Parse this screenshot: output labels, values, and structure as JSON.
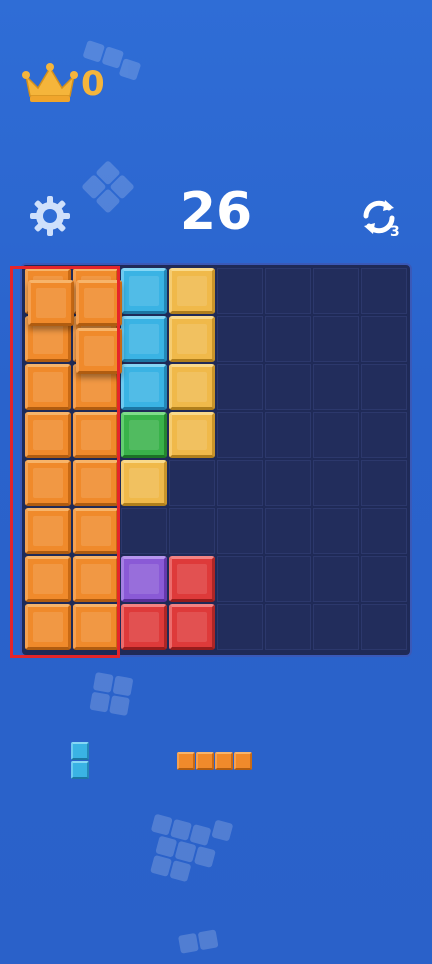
{
  "best_score": "0",
  "score": "26",
  "refresh_count": "3",
  "icons": {
    "crown": "crown-icon",
    "settings": "gear-icon",
    "refresh": "refresh-icon"
  },
  "colors": {
    "background": "#2a63cc",
    "board": "#1f2a57",
    "highlight": "#e5252a",
    "crown": "#f5b53b"
  },
  "board": {
    "columns": 8,
    "rows": 8,
    "grid": [
      [
        "o",
        "o",
        "b",
        "y",
        "",
        "",
        "",
        ""
      ],
      [
        "o",
        "o",
        "b",
        "y",
        "",
        "",
        "",
        ""
      ],
      [
        "o",
        "o",
        "b",
        "y",
        "",
        "",
        "",
        ""
      ],
      [
        "o",
        "o",
        "g",
        "y",
        "",
        "",
        "",
        ""
      ],
      [
        "o",
        "o",
        "y",
        "",
        "",
        "",
        "",
        ""
      ],
      [
        "o",
        "o",
        "",
        "",
        "",
        "",
        "",
        ""
      ],
      [
        "o",
        "o",
        "p",
        "r",
        "",
        "",
        "",
        ""
      ],
      [
        "o",
        "o",
        "r",
        "r",
        "",
        "",
        "",
        ""
      ]
    ]
  },
  "dragged_piece": {
    "color": "o",
    "cells": [
      [
        0,
        0
      ],
      [
        0,
        1
      ],
      [
        1,
        1
      ]
    ]
  },
  "tray": [
    {
      "name": "vertical-2-piece",
      "color": "b",
      "cells": [
        [
          0,
          0
        ],
        [
          1,
          0
        ]
      ]
    },
    {
      "name": "horizontal-4-piece",
      "color": "o",
      "cells": [
        [
          0,
          0
        ],
        [
          0,
          1
        ],
        [
          0,
          2
        ],
        [
          0,
          3
        ]
      ]
    }
  ]
}
